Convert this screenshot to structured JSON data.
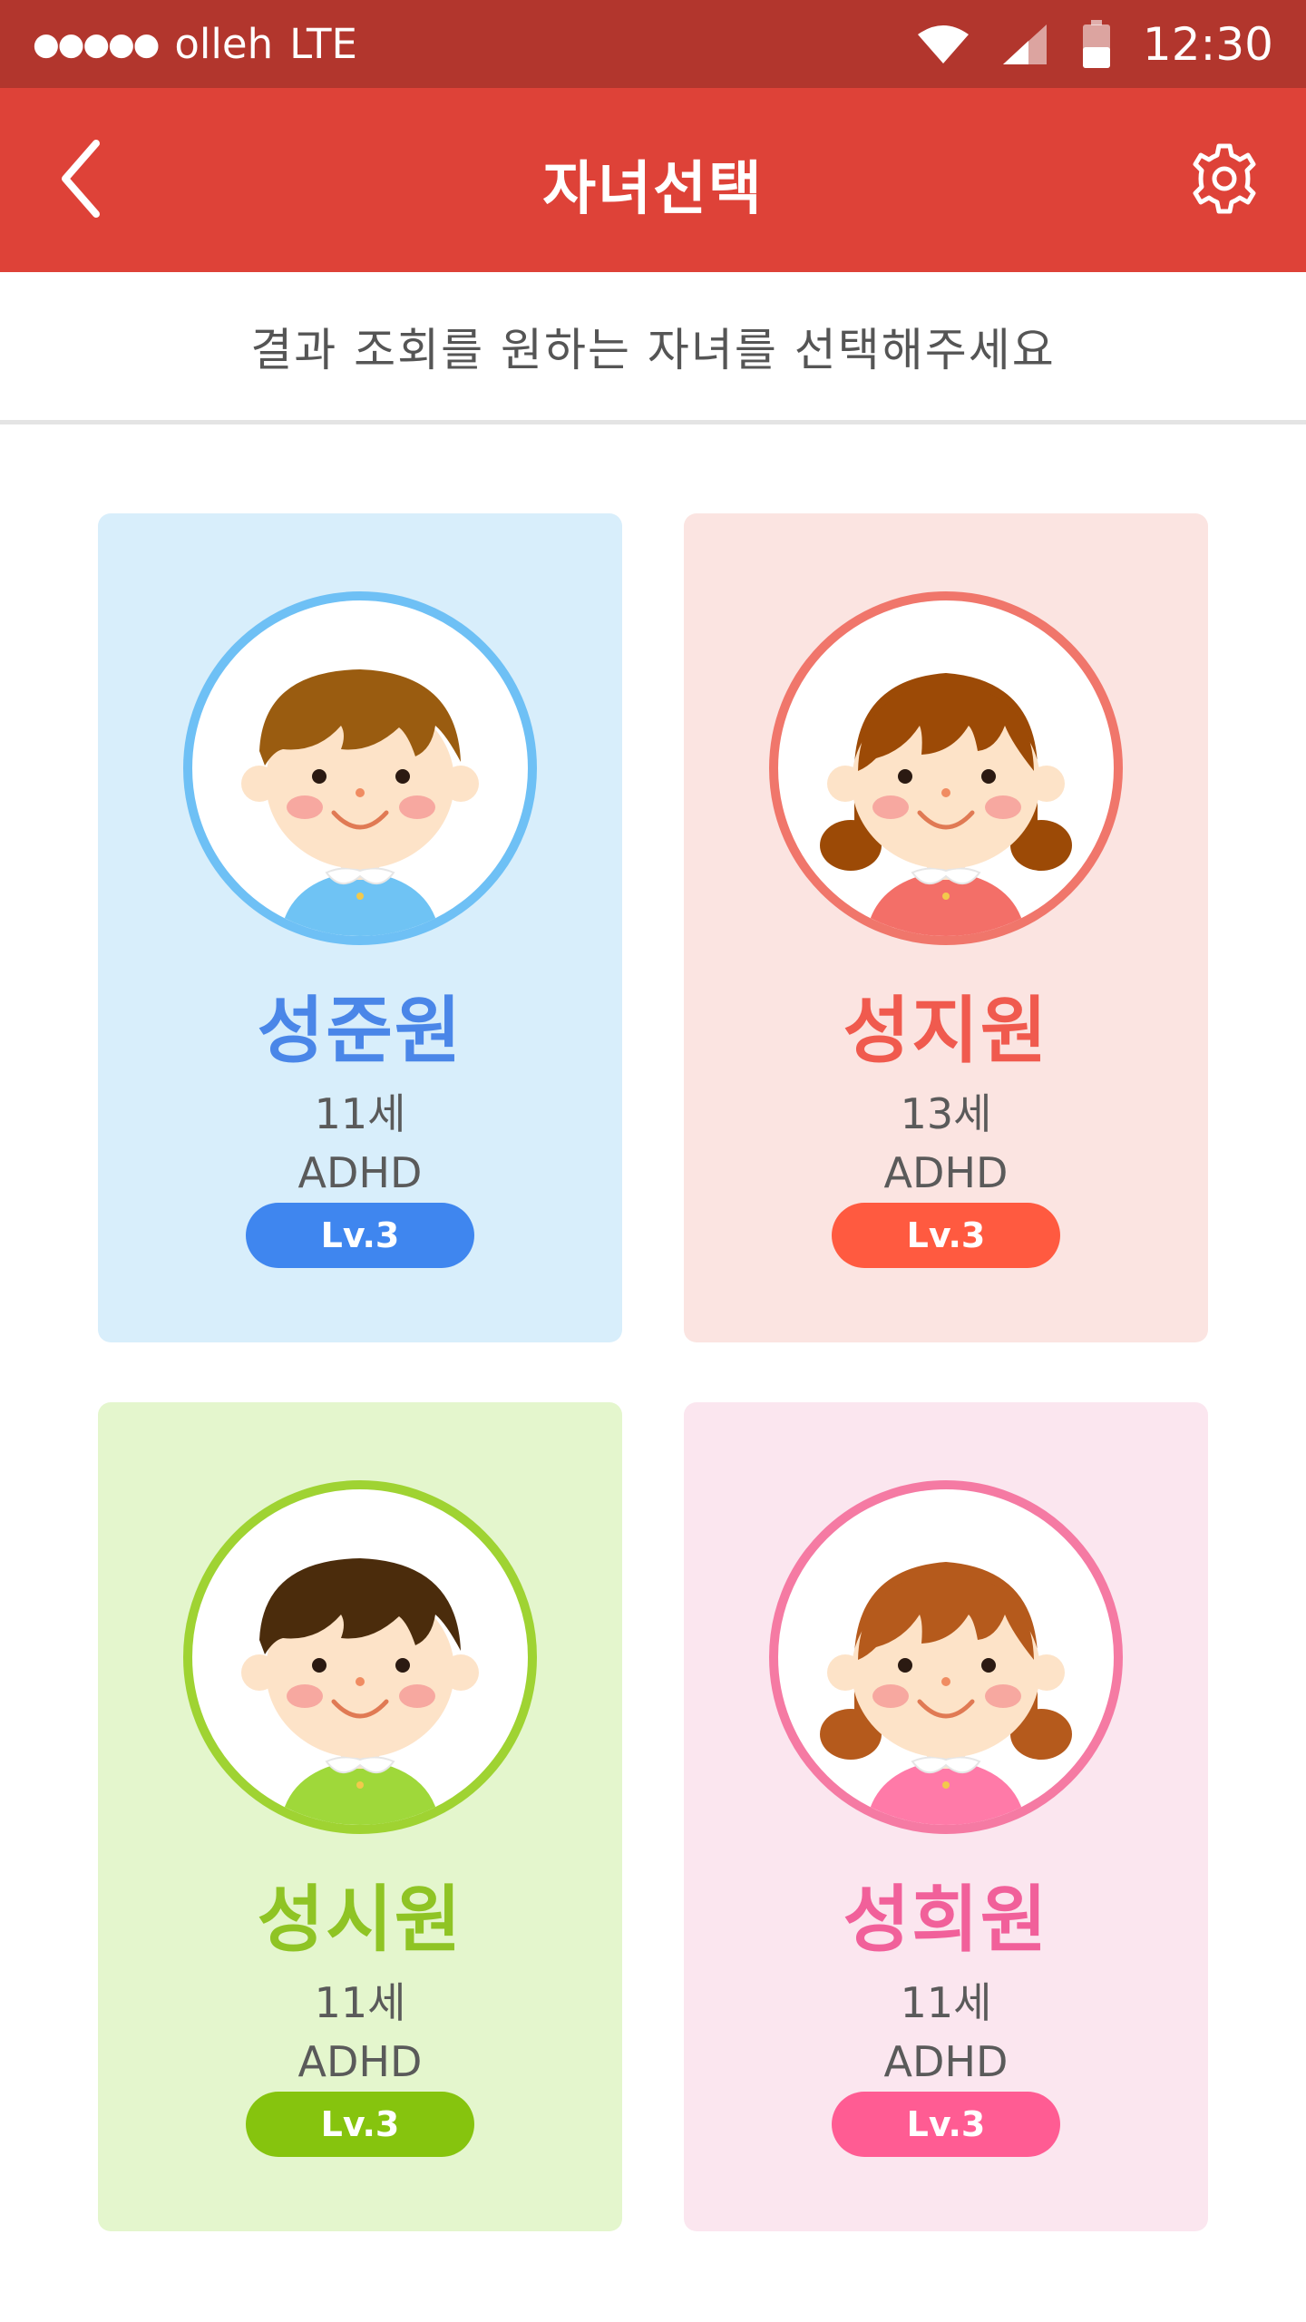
{
  "status_bar": {
    "carrier": "olleh",
    "network": "LTE",
    "time": "12:30"
  },
  "app_bar": {
    "title": "자녀선택",
    "back_icon": "chevron-left-icon",
    "settings_icon": "gear-icon"
  },
  "subtitle": "결과 조회를 원하는 자녀를 선택해주세요",
  "children": [
    {
      "name": "성준원",
      "age": "11세",
      "diagnosis": "ADHD",
      "level": "Lv.3",
      "gender": "boy",
      "bg": "#d8eefb",
      "accent": "#4a86e8",
      "ring": "#6ec0f5",
      "badge": "#3f86ef",
      "hair": "#9a5c10",
      "shirt": "#6fc3f4"
    },
    {
      "name": "성지원",
      "age": "13세",
      "diagnosis": "ADHD",
      "level": "Lv.3",
      "gender": "girl",
      "bg": "#fbe4e1",
      "accent": "#f05a4e",
      "ring": "#f0766b",
      "badge": "#ff5a40",
      "hair": "#9c4a06",
      "shirt": "#f36f68"
    },
    {
      "name": "성시원",
      "age": "11세",
      "diagnosis": "ADHD",
      "level": "Lv.3",
      "gender": "boy",
      "bg": "#e4f6cd",
      "accent": "#8fc424",
      "ring": "#9fd332",
      "badge": "#86c40e",
      "hair": "#4b2c0c",
      "shirt": "#9fd83a"
    },
    {
      "name": "성희원",
      "age": "11세",
      "diagnosis": "ADHD",
      "level": "Lv.3",
      "gender": "girl",
      "bg": "#fbe6ef",
      "accent": "#f1609a",
      "ring": "#f57aa3",
      "badge": "#ff5c93",
      "hair": "#b55a1c",
      "shirt": "#ff7aa8"
    }
  ]
}
